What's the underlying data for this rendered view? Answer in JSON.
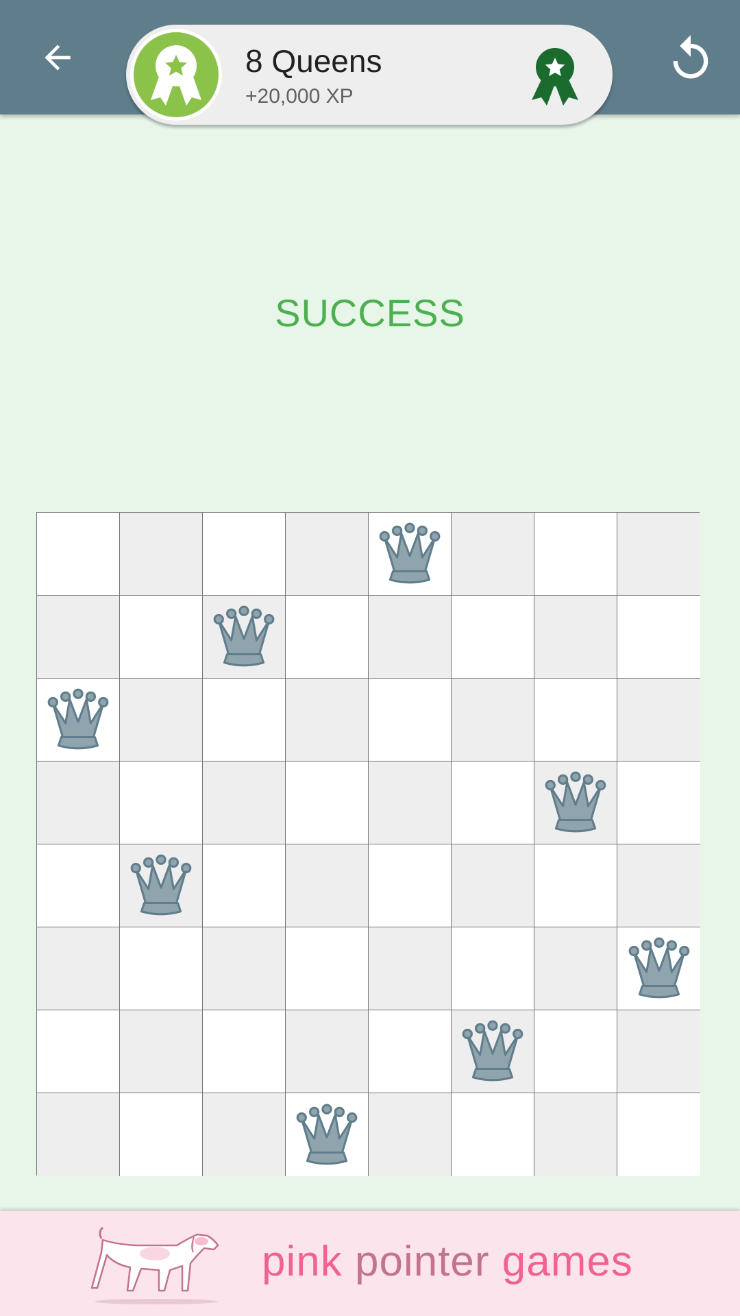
{
  "header": {
    "title": "8 Queens",
    "xp": "+20,000 XP",
    "back_icon": "arrow-left-icon",
    "restart_icon": "restart-icon",
    "badge_icon": "award-ribbon-icon",
    "award_icon": "award-ribbon-icon",
    "colors": {
      "bar": "#607d8b",
      "badge": "#8bc34a",
      "award": "#1b6b2f"
    }
  },
  "status": {
    "text": "SUCCESS",
    "color": "#4caf50"
  },
  "board": {
    "size": 8,
    "queens": [
      [
        0,
        4
      ],
      [
        1,
        2
      ],
      [
        2,
        0
      ],
      [
        3,
        6
      ],
      [
        4,
        1
      ],
      [
        5,
        7
      ],
      [
        6,
        5
      ],
      [
        7,
        3
      ]
    ],
    "colors": {
      "light": "#ffffff",
      "dark": "#eeeeee",
      "queen": "#90a4ae",
      "queen_outline": "#607d8b"
    }
  },
  "footer": {
    "brand": [
      "pink",
      "pointer",
      "games"
    ],
    "logo_icon": "pointer-dog-icon"
  }
}
